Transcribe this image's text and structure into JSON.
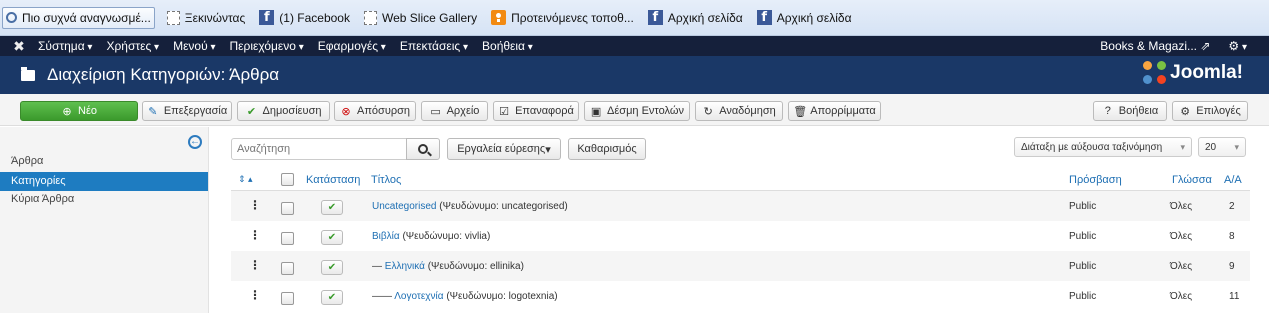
{
  "favbar": {
    "items": [
      {
        "label": "Πιο συχνά αναγνωσμέ...",
        "icon": "search-icon"
      },
      {
        "label": "Ξεκινώντας",
        "icon": "blank-page-icon"
      },
      {
        "label": "(1) Facebook",
        "icon": "facebook-icon"
      },
      {
        "label": "Web Slice Gallery",
        "icon": "blank-page-icon"
      },
      {
        "label": "Προτεινόμενες τοποθ...",
        "icon": "rss-icon"
      },
      {
        "label": "Αρχική σελίδα",
        "icon": "facebook-icon"
      },
      {
        "label": "Αρχική σελίδα",
        "icon": "facebook-icon"
      }
    ]
  },
  "navbar": {
    "menu": [
      "Σύστημα",
      "Χρήστες",
      "Μενού",
      "Περιεχόμενο",
      "Εφαρμογές",
      "Επεκτάσεις",
      "Βοήθεια"
    ],
    "site": "Books & Magazi...",
    "site_icon": "external-link-icon",
    "settings_icon": "gear-icon"
  },
  "header": {
    "title": "Διαχείριση Κατηγοριών: Άρθρα",
    "brand": "Joomla!"
  },
  "toolbar": {
    "new": "Νέο",
    "edit": "Επεξεργασία",
    "publish": "Δημοσίευση",
    "unpublish": "Απόσυρση",
    "archive": "Αρχείο",
    "checkin": "Επαναφορά",
    "batch": "Δέσμη Εντολών",
    "rebuild": "Αναδόμηση",
    "trash": "Απορρίμματα",
    "help": "Βοήθεια",
    "options": "Επιλογές"
  },
  "sidebar": {
    "items": [
      {
        "label": "Άρθρα",
        "active": false
      },
      {
        "label": "Κατηγορίες",
        "active": true
      },
      {
        "label": "Κύρια Άρθρα",
        "active": false
      }
    ]
  },
  "filters": {
    "search_placeholder": "Αναζήτηση",
    "search_tools": "Εργαλεία εύρεσης",
    "clear": "Καθαρισμός",
    "sort": "Διάταξη με αύξουσα ταξινόμηση",
    "limit": "20"
  },
  "table": {
    "headers": {
      "status": "Κατάσταση",
      "title": "Τίτλος",
      "access": "Πρόσβαση",
      "language": "Γλώσσα",
      "id": "Α/Α"
    },
    "rows": [
      {
        "prefix": "",
        "title": "Uncategorised",
        "alias": "(Ψευδώνυμο: uncategorised)",
        "access": "Public",
        "language": "Όλες",
        "id": "2"
      },
      {
        "prefix": "",
        "title": "Βιβλία",
        "alias": "(Ψευδώνυμο: vivlia)",
        "access": "Public",
        "language": "Όλες",
        "id": "8"
      },
      {
        "prefix": "—",
        "title": "Ελληνικά",
        "alias": "(Ψευδώνυμο: ellinika)",
        "access": "Public",
        "language": "Όλες",
        "id": "9"
      },
      {
        "prefix": "——",
        "title": "Λογοτεχνία",
        "alias": "(Ψευδώνυμο: logotexnia)",
        "access": "Public",
        "language": "Όλες",
        "id": "11"
      }
    ]
  }
}
